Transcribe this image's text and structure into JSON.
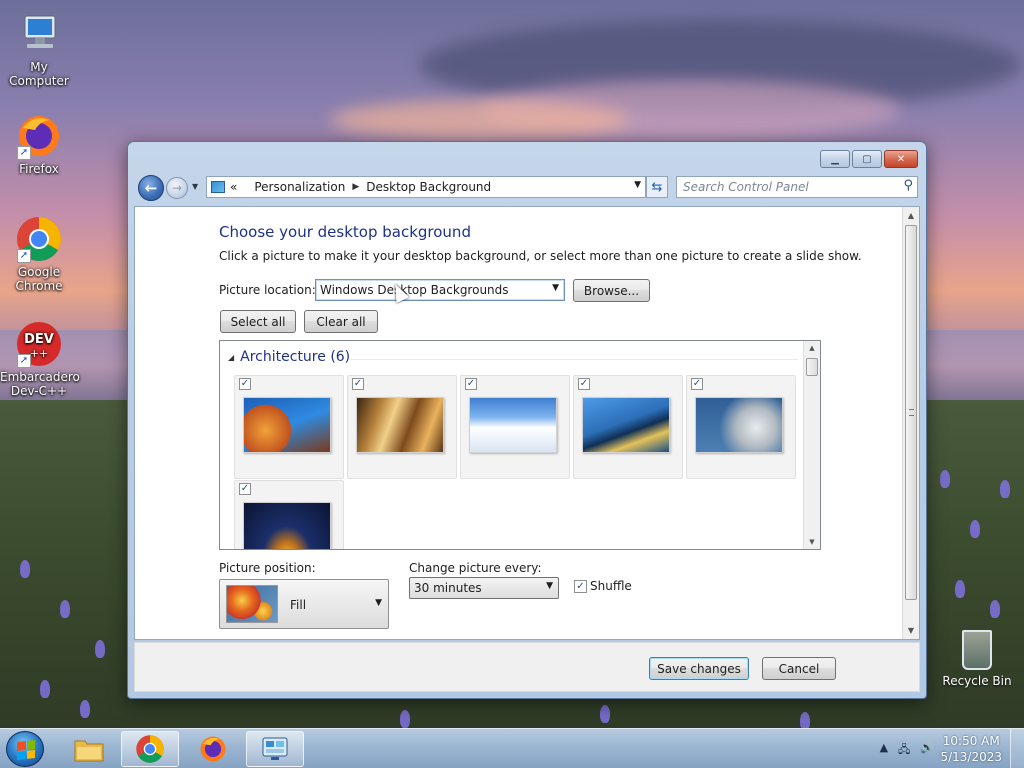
{
  "desktop": {
    "icons": [
      {
        "label": "My Computer"
      },
      {
        "label": "Firefox"
      },
      {
        "label": "Google Chrome"
      },
      {
        "label": "Embarcadero Dev-C++",
        "logo_text": "DEV"
      }
    ],
    "recycle_bin": "Recycle Bin"
  },
  "window": {
    "address": {
      "crumb_prefix": "«",
      "crumbs": [
        "Personalization",
        "Desktop Background"
      ]
    },
    "search_placeholder": "Search Control Panel",
    "heading": "Choose your desktop background",
    "subtext": "Click a picture to make it your desktop background, or select more than one picture to create a slide show.",
    "picture_location": {
      "label": "Picture location:",
      "value": "Windows Desktop Backgrounds",
      "browse_label": "Browse..."
    },
    "select_all_label": "Select all",
    "clear_all_label": "Clear all",
    "gallery": {
      "group_title": "Architecture (6)",
      "items": [
        {
          "name": "architecture-1",
          "checked": true
        },
        {
          "name": "architecture-2",
          "checked": true
        },
        {
          "name": "architecture-3",
          "checked": true
        },
        {
          "name": "architecture-4",
          "checked": true
        },
        {
          "name": "architecture-5",
          "checked": true
        },
        {
          "name": "architecture-6",
          "checked": true
        }
      ]
    },
    "picture_position": {
      "label": "Picture position:",
      "value": "Fill"
    },
    "change_every": {
      "label": "Change picture every:",
      "value": "30 minutes"
    },
    "shuffle": {
      "label": "Shuffle",
      "checked": true
    },
    "save_label": "Save changes",
    "cancel_label": "Cancel"
  },
  "taskbar": {
    "clock_time": "10:50 AM",
    "clock_date": "5/13/2023"
  },
  "colors": {
    "heading": "#1e3287",
    "accent": "#3c7fb1"
  }
}
